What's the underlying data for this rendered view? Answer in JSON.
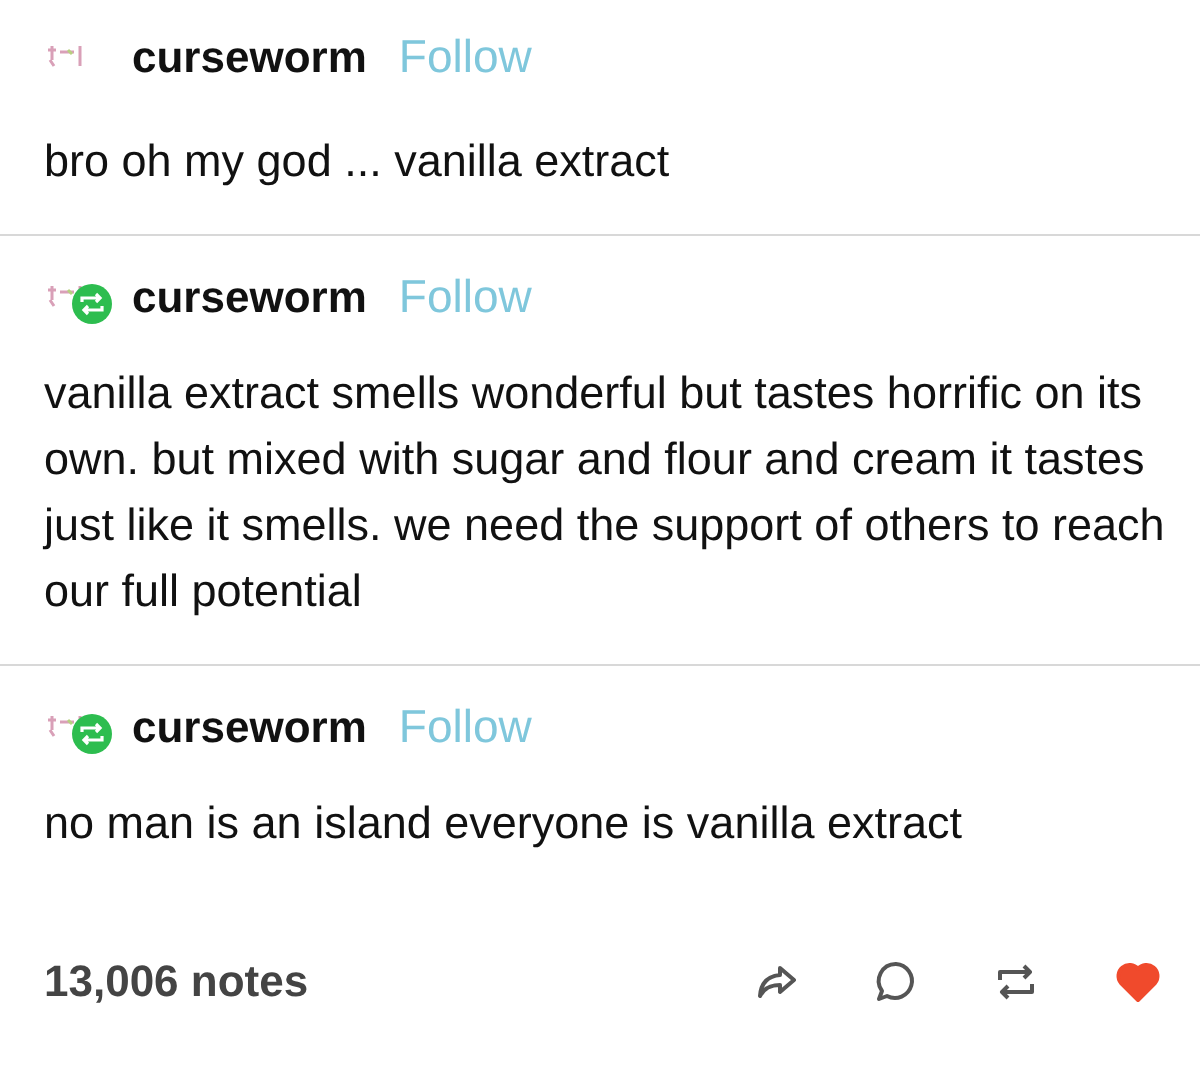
{
  "posts": [
    {
      "username": "curseworm",
      "follow": "Follow",
      "reblogged": false,
      "text": "bro oh my god ... vanilla extract"
    },
    {
      "username": "curseworm",
      "follow": "Follow",
      "reblogged": true,
      "text": "vanilla extract smells wonderful but tastes horrific on its own. but mixed with sugar and flour and cream it tastes just like it smells. we need the support of others to reach our full potential"
    },
    {
      "username": "curseworm",
      "follow": "Follow",
      "reblogged": true,
      "text": "no man is an island everyone is vanilla extract"
    }
  ],
  "footer": {
    "notes": "13,006 notes",
    "liked": true
  }
}
